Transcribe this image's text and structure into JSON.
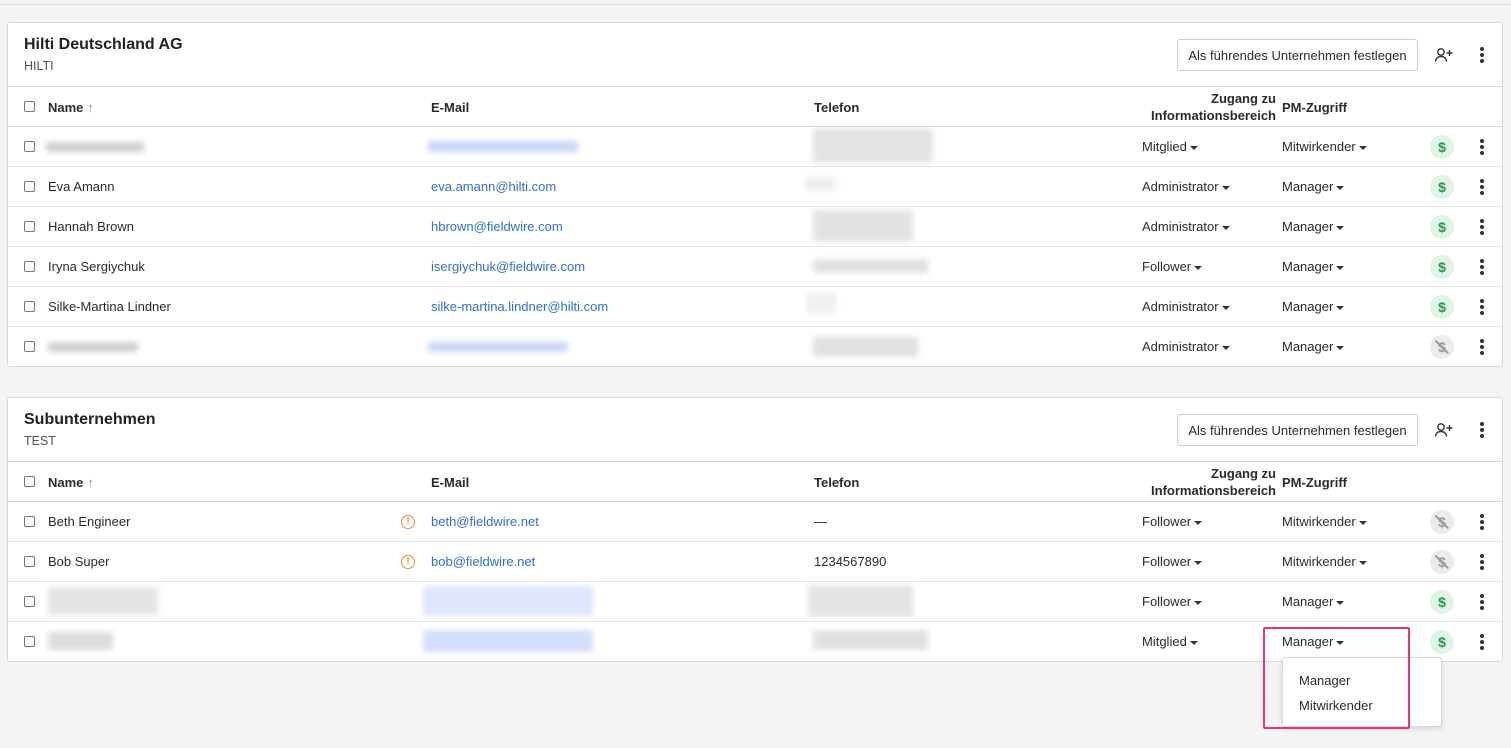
{
  "table_headers": {
    "name": "Name",
    "email": "E-Mail",
    "telefon": "Telefon",
    "zugang_line1": "Zugang zu",
    "zugang_line2": "Informationsbereich",
    "pm": "PM-Zugriff"
  },
  "lead_button_label": "Als führendes Unternehmen festlegen",
  "icons": {
    "sort": "arrow-up-icon",
    "add_user": "person-plus-icon",
    "menu": "kebab-menu-icon",
    "billing": "dollar-icon",
    "billing_off": "dollar-strike-icon",
    "warning": "exclamation-circle-icon"
  },
  "colors": {
    "link": "#2f6fdc",
    "billing_on": "#1f9d4c",
    "warning": "#e8892b",
    "highlight": "#e8356d"
  },
  "companies": [
    {
      "title": "Hilti Deutschland AG",
      "subtitle": "HILTI",
      "rows": [
        {
          "name": "",
          "email": "",
          "telefon": "",
          "zugang": "Mitglied",
          "pm": "Mitwirkender",
          "billing": true
        },
        {
          "name": "Eva Amann",
          "email": "eva.amann@hilti.com",
          "telefon": "",
          "zugang": "Administrator",
          "pm": "Manager",
          "billing": true
        },
        {
          "name": "Hannah Brown",
          "email": "hbrown@fieldwire.com",
          "telefon": "",
          "zugang": "Administrator",
          "pm": "Manager",
          "billing": true
        },
        {
          "name": "Iryna Sergiychuk",
          "email": "isergiychuk@fieldwire.com",
          "telefon": "",
          "zugang": "Follower",
          "pm": "Manager",
          "billing": true
        },
        {
          "name": "Silke-Martina Lindner",
          "email": "silke-martina.lindner@hilti.com",
          "telefon": "",
          "zugang": "Administrator",
          "pm": "Manager",
          "billing": true
        },
        {
          "name": "",
          "email": "",
          "telefon": "",
          "zugang": "Administrator",
          "pm": "Manager",
          "billing": false
        }
      ]
    },
    {
      "title": "Subunternehmen",
      "subtitle": "TEST",
      "rows": [
        {
          "name": "Beth Engineer",
          "email": "beth@fieldwire.net",
          "telefon": "—",
          "zugang": "Follower",
          "pm": "Mitwirkender",
          "billing": false,
          "warning": true
        },
        {
          "name": "Bob Super",
          "email": "bob@fieldwire.net",
          "telefon": "1234567890",
          "zugang": "Follower",
          "pm": "Mitwirkender",
          "billing": false,
          "warning": true
        },
        {
          "name": "",
          "email": "",
          "telefon": "",
          "zugang": "Follower",
          "pm": "Manager",
          "billing": true
        },
        {
          "name": "",
          "email": "",
          "telefon": "",
          "zugang": "Mitglied",
          "pm": "Manager",
          "billing": true
        }
      ]
    }
  ],
  "pm_dropdown": {
    "options": [
      "Manager",
      "Mitwirkender"
    ]
  }
}
